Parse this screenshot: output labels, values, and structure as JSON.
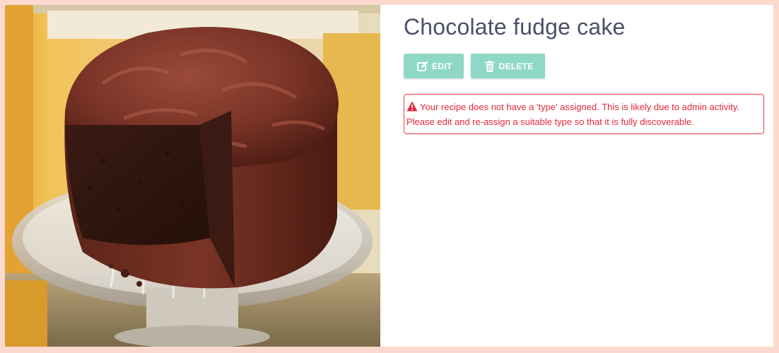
{
  "recipe": {
    "title": "Chocolate fudge cake",
    "image_alt": "Chocolate fudge cake on a glass cake stand"
  },
  "actions": {
    "edit_label": "EDIT",
    "delete_label": "DELETE",
    "edit_icon": "edit-icon",
    "delete_icon": "trash-icon"
  },
  "alert": {
    "icon": "warning-icon",
    "message": "Your recipe does not have a 'type' assigned. This is likely due to admin activity. Please edit and re-assign a suitable type so that it is fully discoverable."
  },
  "colors": {
    "page_background": "#fbd9cf",
    "button": "#8fd8c7",
    "alert": "#e5283a",
    "title": "#4a5069"
  }
}
